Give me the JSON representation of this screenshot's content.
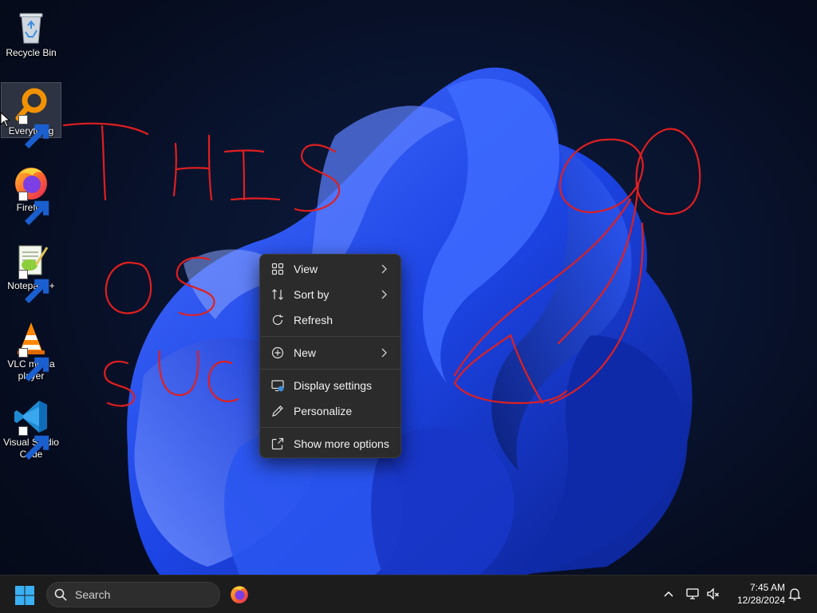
{
  "desktop": {
    "icons": [
      {
        "label": "Recycle Bin",
        "icon": "recycle-bin-icon"
      },
      {
        "label": "Everything",
        "icon": "everything-search-icon",
        "selected": true
      },
      {
        "label": "Firefox",
        "icon": "firefox-icon"
      },
      {
        "label": "Notepad++",
        "icon": "notepad-plus-plus-icon"
      },
      {
        "label": "VLC media player",
        "icon": "vlc-icon"
      },
      {
        "label": "Visual Studio Code",
        "icon": "vscode-icon"
      }
    ]
  },
  "context_menu": {
    "items": [
      {
        "label": "View",
        "icon": "view-grid-icon",
        "submenu": true
      },
      {
        "label": "Sort by",
        "icon": "sort-icon",
        "submenu": true
      },
      {
        "label": "Refresh",
        "icon": "refresh-icon",
        "submenu": false
      },
      {
        "label": "New",
        "icon": "new-plus-icon",
        "submenu": true
      },
      {
        "label": "Display settings",
        "icon": "display-settings-icon",
        "submenu": false
      },
      {
        "label": "Personalize",
        "icon": "personalize-pen-icon",
        "submenu": false
      },
      {
        "label": "Show more options",
        "icon": "show-more-options-icon",
        "submenu": false
      }
    ]
  },
  "taskbar": {
    "search_label": "Search",
    "pinned": [
      "firefox-icon"
    ],
    "tray_icons": [
      "chevron-up-icon",
      "network-icon",
      "volume-muted-icon",
      "notification-bell-icon"
    ],
    "clock": {
      "time": "7:45 AM",
      "date": "12/28/2024"
    }
  },
  "colors": {
    "accent": "#0078d4",
    "menu_bg": "#2b2b2b",
    "taskbar_bg": "#1c1c1c",
    "scribble": "#e01f1f",
    "wallpaper_bloom": "#1f46e0"
  }
}
